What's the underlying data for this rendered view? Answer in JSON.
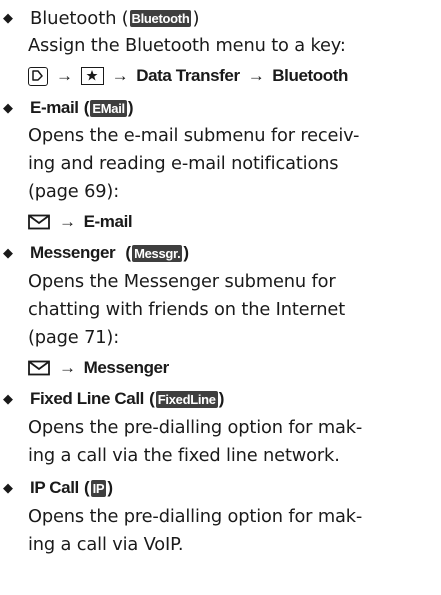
{
  "items": [
    {
      "label": "Bluetooth",
      "open_paren": "(",
      "key": "Bluetooth",
      "close_paren": ")",
      "lines": [
        "Assign the Bluetooth menu to a key:"
      ],
      "path": {
        "icons": [
          "menu-key-icon",
          "star-key-icon"
        ],
        "steps": [
          "Data Transfer",
          "Bluetooth"
        ]
      }
    },
    {
      "label": "E-mail",
      "open_paren": "(",
      "key": "EMail",
      "close_paren": ")",
      "lines": [
        "Opens the e-mail submenu for receiv-",
        "ing and reading e-mail notifications",
        "(page 69):"
      ],
      "path": {
        "icons": [
          "envelope-icon"
        ],
        "steps": [
          "E-mail"
        ]
      }
    },
    {
      "label": "Messenger",
      "open_paren": "(",
      "key": "Messgr.",
      "close_paren": ")",
      "lines": [
        "Opens the Messenger submenu for",
        "chatting with friends on the Internet",
        "(page 71):"
      ],
      "path": {
        "icons": [
          "envelope-icon"
        ],
        "steps": [
          "Messenger"
        ]
      }
    },
    {
      "label": "Fixed Line Call",
      "open_paren": "(",
      "key": "FixedLine",
      "close_paren": ")",
      "lines": [
        "Opens the pre-dialling option for mak-",
        "ing a call via the fixed line network."
      ]
    },
    {
      "label": "IP Call",
      "open_paren": "(",
      "key": "IP",
      "close_paren": ")",
      "lines": [
        "Opens the pre-dialling option for mak-",
        "ing a call via VoIP."
      ]
    }
  ],
  "arrow": "→",
  "bullet": "◆"
}
